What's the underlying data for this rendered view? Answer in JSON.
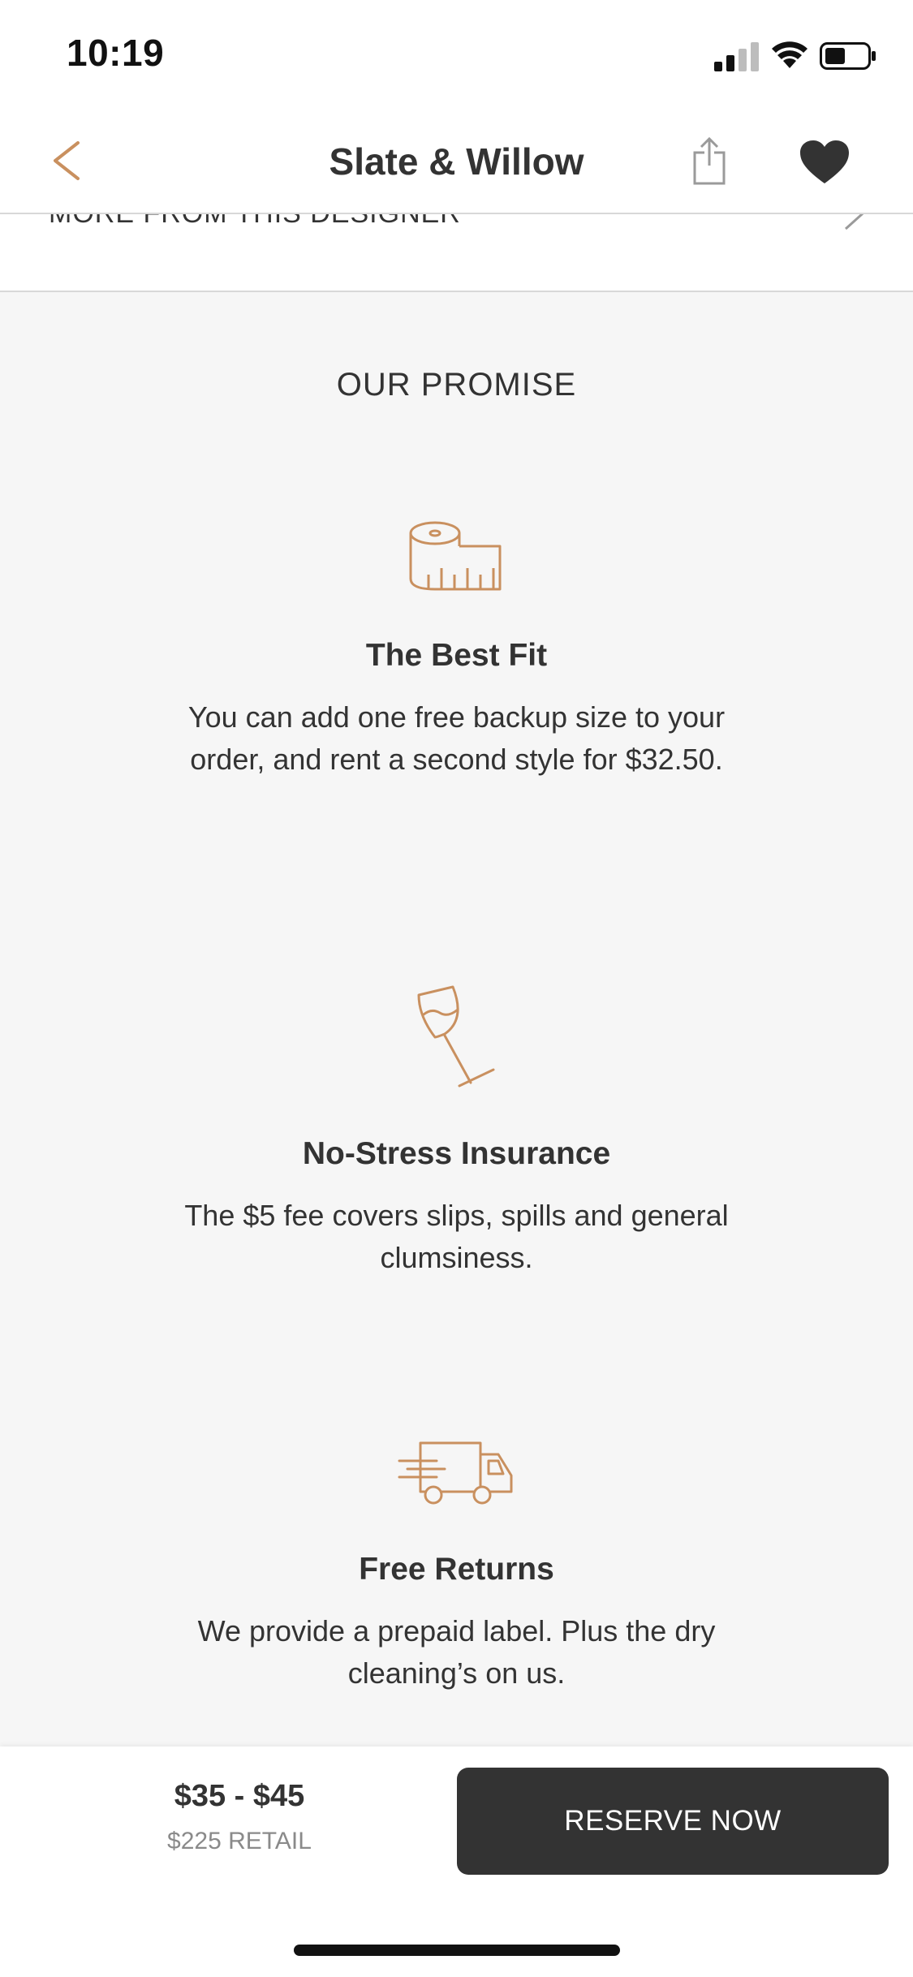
{
  "status_bar": {
    "time": "10:19"
  },
  "nav": {
    "title": "Slate & Willow"
  },
  "designer_row": {
    "label": "MORE FROM THIS DESIGNER"
  },
  "promise": {
    "heading": "OUR PROMISE",
    "features": [
      {
        "icon": "tape-measure-icon",
        "title": "The Best Fit",
        "text": "You can add one free backup size to your order, and rent a second style for $32.50."
      },
      {
        "icon": "wine-glass-icon",
        "title": "No-Stress Insurance",
        "text": "The $5 fee covers slips, spills and general clumsiness."
      },
      {
        "icon": "delivery-truck-icon",
        "title": "Free Returns",
        "text": "We provide a prepaid label. Plus the dry cleaning’s on us."
      }
    ]
  },
  "bottom_bar": {
    "price_range": "$35 - $45",
    "retail": "$225 RETAIL",
    "reserve_label": "RESERVE NOW"
  },
  "colors": {
    "accent": "#c9905f",
    "dark": "#333333",
    "background": "#f6f6f6"
  }
}
